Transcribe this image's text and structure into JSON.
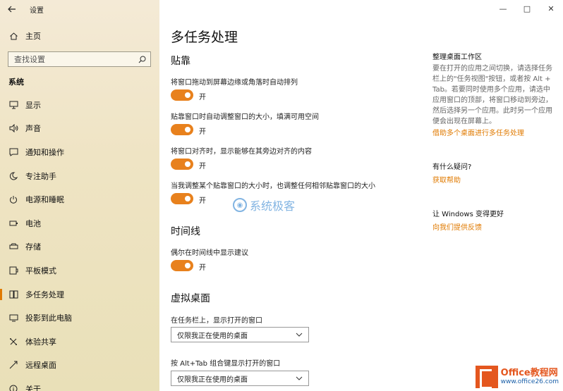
{
  "window": {
    "title": "设置"
  },
  "sidebar": {
    "home_label": "主页",
    "search_placeholder": "查找设置",
    "section_label": "系统",
    "items": [
      {
        "label": "显示",
        "icon": "monitor-icon"
      },
      {
        "label": "声音",
        "icon": "speaker-icon"
      },
      {
        "label": "通知和操作",
        "icon": "notification-icon"
      },
      {
        "label": "专注助手",
        "icon": "moon-icon"
      },
      {
        "label": "电源和睡眠",
        "icon": "power-icon"
      },
      {
        "label": "电池",
        "icon": "battery-icon"
      },
      {
        "label": "存储",
        "icon": "storage-icon"
      },
      {
        "label": "平板模式",
        "icon": "tablet-icon"
      },
      {
        "label": "多任务处理",
        "icon": "multitask-icon",
        "active": true
      },
      {
        "label": "投影到此电脑",
        "icon": "project-icon"
      },
      {
        "label": "体验共享",
        "icon": "share-icon"
      },
      {
        "label": "远程桌面",
        "icon": "remote-icon"
      },
      {
        "label": "关于",
        "icon": "info-icon"
      }
    ]
  },
  "main": {
    "title": "多任务处理",
    "snap": {
      "heading": "贴靠",
      "options": [
        {
          "label": "将窗口拖动到屏幕边缘或角落时自动排列",
          "state": "开"
        },
        {
          "label": "贴靠窗口时自动调整窗口的大小，填满可用空间",
          "state": "开"
        },
        {
          "label": "将窗口对齐时，显示能够在其旁边对齐的内容",
          "state": "开"
        },
        {
          "label": "当我调整某个贴靠窗口的大小时，也调整任何相邻贴靠窗口的大小",
          "state": "开"
        }
      ]
    },
    "timeline": {
      "heading": "时间线",
      "option": {
        "label": "偶尔在时间线中显示建议",
        "state": "开"
      }
    },
    "virtual_desktops": {
      "heading": "虚拟桌面",
      "taskbar_label": "在任务栏上，显示打开的窗口",
      "taskbar_value": "仅限我正在使用的桌面",
      "alttab_label": "按 Alt+Tab 组合键显示打开的窗口",
      "alttab_value": "仅限我正在使用的桌面"
    }
  },
  "right": {
    "arrange_title": "整理桌面工作区",
    "arrange_text": "要在打开的应用之间切换，请选择任务栏上的\"任务视图\"按钮，或者按 Alt + Tab。若要同时使用多个应用，请选中应用窗口的顶部，将窗口移动到旁边，然后选择另一个应用。此时另一个应用便会出现在屏幕上。",
    "arrange_link": "借助多个桌面进行多任务处理",
    "question_title": "有什么疑问?",
    "help_link": "获取帮助",
    "improve_title": "让 Windows 变得更好",
    "feedback_link": "向我们提供反馈"
  },
  "watermarks": {
    "center": "系统极客",
    "corner_top": "Office教程网",
    "corner_bottom": "www.office26.com"
  },
  "colors": {
    "accent": "#e8811d",
    "link": "#e07a00"
  }
}
